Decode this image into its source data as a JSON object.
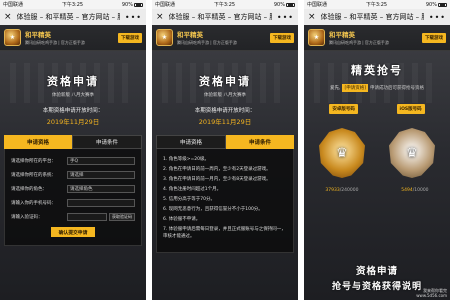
{
  "screens": [
    {
      "status": {
        "carrier": "中国联通",
        "time": "下午3:25",
        "battery": "90%"
      },
      "title": "体验服 – 和平精英 – 官方网站 – 腾...",
      "app": {
        "name": "和平精英",
        "sub": "腾讯自研吃鸡手游 | 官方正版手游",
        "download": "下载游戏"
      },
      "heading": "资格申请",
      "subheading": "体验新版 八月大赛季",
      "period_label": "本期资格申请开放时间：",
      "period_date": "2019年11月29日",
      "tabs": [
        {
          "label": "申请资格"
        },
        {
          "label": "申请条件"
        }
      ],
      "form": [
        {
          "label": "请选择你所在的平台：",
          "value": "手Q"
        },
        {
          "label": "请选择你所在的系统：",
          "value": "请选择"
        },
        {
          "label": "请选择你的角色：",
          "value": "请选择角色"
        },
        {
          "label": "请输入你的手机号码：",
          "value": ""
        },
        {
          "label": "请输入验证码：",
          "value": "",
          "button": "获取验证码"
        }
      ],
      "submit": "确认提交申请"
    },
    {
      "status": {
        "carrier": "中国联通",
        "time": "下午3:25",
        "battery": "90%"
      },
      "title": "体验服 – 和平精英 – 官方网站 – 腾...",
      "app": {
        "name": "和平精英",
        "sub": "腾讯自研吃鸡手游 | 官方正版手游",
        "download": "下载游戏"
      },
      "heading": "资格申请",
      "subheading": "体验新版 八月大赛季",
      "period_label": "本期资格申请开放时间：",
      "period_date": "2019年11月29日",
      "tabs": [
        {
          "label": "申请资格"
        },
        {
          "label": "申请条件"
        }
      ],
      "conditions": [
        "1. 角色等级>=20级。",
        "2. 角色在申请日的前一周内，至少有2天登录过游戏。",
        "3. 角色在申请日的前一月内，至少有8天登录过游戏。",
        "4. 角色注册时间超过1个月。",
        "5. 信用分高于等于70分。",
        "6. 现网无恶意行为，且获得信誉分不小于100分。",
        "6. 体验服不申请。",
        "7. 体验服申请后需每日登录，并且正式服账号与之保持同一，审核才能通过。"
      ]
    },
    {
      "status": {
        "carrier": "中国联通",
        "time": "下午3:25",
        "battery": "90%"
      },
      "title": "体验服 – 和平精英 – 官方网站 – 腾...",
      "app": {
        "name": "和平精英",
        "sub": "腾讯自研吃鸡手游 | 官方正版手游",
        "download": "下载游戏"
      },
      "heading": "精英抢号",
      "user_name": "爱先,",
      "user_status": "[申请资格]",
      "user_hint": "申请成功后可获得抢号资格",
      "platforms": [
        "安卓版号码",
        "iOS版号码"
      ],
      "counts": [
        {
          "value": "37933",
          "total": "/240000"
        },
        {
          "value": "5494",
          "total": "/10000"
        }
      ],
      "footer": [
        "资格申请",
        "抢号与资格获得说明"
      ],
      "watermark": [
        "我来帮你看完",
        "www.5d56.com"
      ]
    }
  ]
}
